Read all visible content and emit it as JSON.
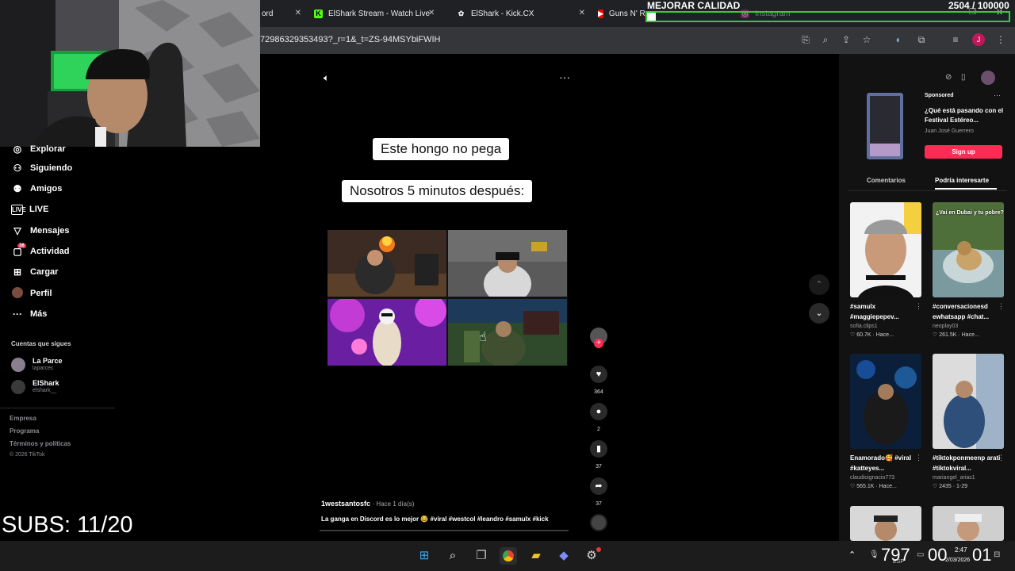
{
  "browser": {
    "tabs": [
      {
        "title": "ord",
        "icon": "discord-icon"
      },
      {
        "title": "ElShark Stream - Watch Live",
        "icon": "kick-icon"
      },
      {
        "title": "ElShark - Kick.CX",
        "icon": "kickcx-icon"
      },
      {
        "title": "Guns N' Roses - Welcome T",
        "icon": "youtube-icon"
      },
      {
        "title": "Instagram",
        "icon": "instagram-icon"
      }
    ],
    "url": "72986329353493?_r=1&_t=ZS-94MSYbiFWIH",
    "profile_initial": "J"
  },
  "overlay": {
    "quality_text": "MEJORAR CALIDAD",
    "goal_count": "2504 / 100000",
    "goal_progress": 0.025,
    "subs_text": "SUBS: 11/20",
    "goal_color": "#2ecc40"
  },
  "sidebar": {
    "items": [
      {
        "label": "Explorar",
        "icon": "compass-icon"
      },
      {
        "label": "Siguiendo",
        "icon": "following-icon"
      },
      {
        "label": "Amigos",
        "icon": "friends-icon"
      },
      {
        "label": "LIVE",
        "icon": "live-icon"
      },
      {
        "label": "Mensajes",
        "icon": "messages-icon"
      },
      {
        "label": "Actividad",
        "icon": "activity-icon",
        "badge": "38"
      },
      {
        "label": "Cargar",
        "icon": "upload-icon"
      },
      {
        "label": "Perfil",
        "icon": "profile-icon"
      },
      {
        "label": "Más",
        "icon": "more-icon"
      }
    ],
    "following_title": "Cuentas que sigues",
    "following": [
      {
        "name": "La Parce",
        "handle": "laparcec"
      },
      {
        "name": "ElShark",
        "handle": "elshark__"
      }
    ],
    "footer": [
      "Empresa",
      "Programa",
      "Términos y políticas",
      "© 2026 TikTok"
    ]
  },
  "video": {
    "caption_top": "Este hongo no pega",
    "caption_bottom": "Nosotros 5 minutos después:",
    "author": "1westsantosfc",
    "time": "· Hace 1 día(s)",
    "description": "La ganga en Discord es lo mejor 😂 #viral #westcol #leandro #samulx #kick",
    "likes": "364",
    "comments": "2",
    "saves": "37",
    "shares": "37"
  },
  "right_panel": {
    "ad": {
      "label": "Sponsored",
      "title": "¿Qué está pasando con el Festival Estéreo...",
      "author": "Juan José Guerrero",
      "cta": "Sign up"
    },
    "tabs": [
      "Comentarios",
      "Podría interesarte"
    ],
    "cards": [
      {
        "title": "#samulx #maggiepepev...",
        "user": "sofia.clips1",
        "meta": "♡ 60.7K · Hace..."
      },
      {
        "title": "#conversacionesd ewhatsapp #chat...",
        "user": "neoplay03",
        "meta": "♡ 261.5K · Hace..."
      },
      {
        "title": "Enamorado🥰 #viral #katteyes...",
        "user": "claudioignacio773",
        "meta": "♡ 565.1K · Hace..."
      },
      {
        "title": "#tiktokponmeenp arati #tiktokviral...",
        "user": "mariangel_arias1",
        "meta": "♡ 2435 · 1-29"
      }
    ],
    "thumb_text_1": "¿Vai en Dubai y tu pobre?"
  },
  "taskbar": {
    "cam_left": "797",
    "cam_mid": "00",
    "cam_right": "01",
    "time": "2:47",
    "date": "2/03/2026",
    "lang": "ESP"
  }
}
